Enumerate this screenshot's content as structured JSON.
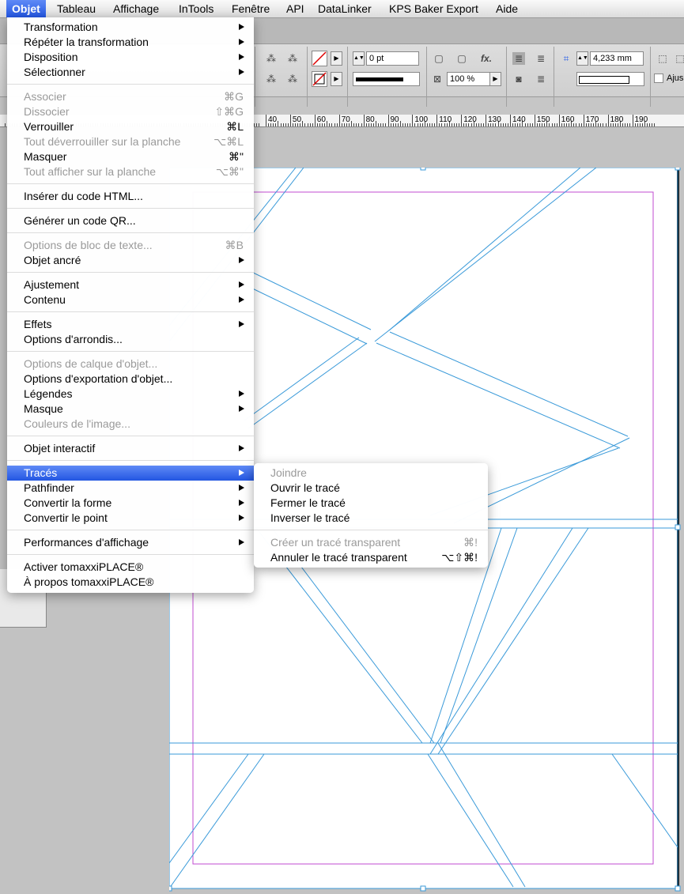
{
  "menubar": {
    "apple": "",
    "items": [
      "Objet",
      "Tableau",
      "Affichage",
      "InTools",
      "Fenêtre",
      "API",
      "DataLinker",
      "KPS Baker Export",
      "Aide"
    ]
  },
  "controlbar": {
    "stroke_weight": "0 pt",
    "opacity": "100 %",
    "gutter": "4,233 mm",
    "fx_label": "fx.",
    "ajust": "Ajus"
  },
  "ruler": {
    "labels": [
      "40",
      "50",
      "60",
      "70",
      "80",
      "90",
      "100",
      "110",
      "120",
      "130",
      "140",
      "150",
      "160",
      "170",
      "180",
      "190"
    ]
  },
  "main_menu": {
    "items": [
      {
        "label": "Transformation",
        "submenu": true
      },
      {
        "label": "Répéter la transformation",
        "submenu": true
      },
      {
        "label": "Disposition",
        "submenu": true
      },
      {
        "label": "Sélectionner",
        "submenu": true
      },
      {
        "sep": true
      },
      {
        "label": "Associer",
        "shortcut": "⌘G",
        "disabled": true
      },
      {
        "label": "Dissocier",
        "shortcut": "⇧⌘G",
        "disabled": true
      },
      {
        "label": "Verrouiller",
        "shortcut": "⌘L"
      },
      {
        "label": "Tout déverrouiller sur la planche",
        "shortcut": "⌥⌘L",
        "disabled": true
      },
      {
        "label": "Masquer",
        "shortcut": "⌘\""
      },
      {
        "label": "Tout afficher sur la planche",
        "shortcut": "⌥⌘\"",
        "disabled": true
      },
      {
        "sep": true
      },
      {
        "label": "Insérer du code HTML..."
      },
      {
        "sep": true
      },
      {
        "label": "Générer un code QR..."
      },
      {
        "sep": true
      },
      {
        "label": "Options de bloc de texte...",
        "shortcut": "⌘B",
        "disabled": true
      },
      {
        "label": "Objet ancré",
        "submenu": true
      },
      {
        "sep": true
      },
      {
        "label": "Ajustement",
        "submenu": true
      },
      {
        "label": "Contenu",
        "submenu": true
      },
      {
        "sep": true
      },
      {
        "label": "Effets",
        "submenu": true
      },
      {
        "label": "Options d'arrondis..."
      },
      {
        "sep": true
      },
      {
        "label": "Options de calque d'objet...",
        "disabled": true
      },
      {
        "label": "Options d'exportation d'objet..."
      },
      {
        "label": "Légendes",
        "submenu": true
      },
      {
        "label": "Masque",
        "submenu": true
      },
      {
        "label": "Couleurs de l'image...",
        "disabled": true
      },
      {
        "sep": true
      },
      {
        "label": "Objet interactif",
        "submenu": true
      },
      {
        "sep": true
      },
      {
        "label": "Tracés",
        "submenu": true,
        "highlight": true
      },
      {
        "label": "Pathfinder",
        "submenu": true
      },
      {
        "label": "Convertir la forme",
        "submenu": true
      },
      {
        "label": "Convertir le point",
        "submenu": true
      },
      {
        "sep": true
      },
      {
        "label": "Performances d'affichage",
        "submenu": true
      },
      {
        "sep": true
      },
      {
        "label": "Activer tomaxxiPLACE®"
      },
      {
        "label": "À propos tomaxxiPLACE®"
      }
    ]
  },
  "sub_menu": {
    "items": [
      {
        "label": "Joindre",
        "disabled": true
      },
      {
        "label": "Ouvrir le tracé"
      },
      {
        "label": "Fermer le tracé"
      },
      {
        "label": "Inverser le tracé"
      },
      {
        "sep": true
      },
      {
        "label": "Créer un tracé transparent",
        "shortcut": "⌘!",
        "disabled": true
      },
      {
        "label": "Annuler le tracé transparent",
        "shortcut": "⌥⇧⌘!"
      }
    ]
  },
  "colors": {
    "accent": "#2f63e8",
    "guide": "#c04bd0",
    "path": "#3a9ad9"
  }
}
